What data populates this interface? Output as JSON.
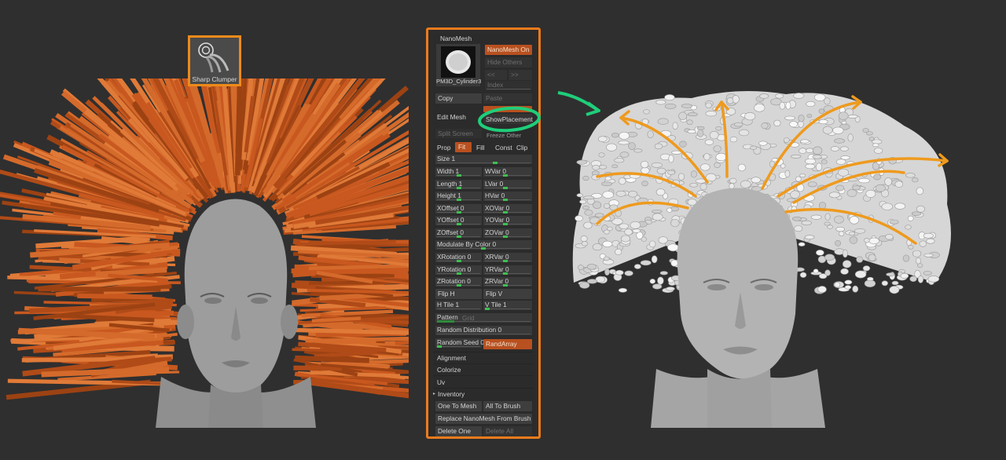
{
  "colors": {
    "accent": "#ee8a1a",
    "hair": "#c8581f",
    "highlight_circle": "#1fce7a",
    "arrow": "#ee9a1e",
    "slider": "#3fbf52"
  },
  "brush": {
    "label": "Sharp Clumper",
    "icon": "clumper-brush-icon"
  },
  "panel": {
    "title": "NanoMesh",
    "thumb_label": "PM3D_Cylinder3",
    "nanomesh_on": "NanoMesh On",
    "hide_others": "Hide Others",
    "prev": "<<",
    "next": ">>",
    "index": "Index",
    "copy": "Copy",
    "paste": "Paste",
    "edit_mesh": "Edit Mesh",
    "show_placement": "ShowPlacement",
    "split_screen": "Split Screen",
    "freeze": "Freeze Other",
    "prop": "Prop",
    "fit": "Fit",
    "fill": "Fill",
    "const": "Const",
    "clip": "Clip",
    "size": "Size 1",
    "width": "Width 1",
    "wvar": "WVar 0",
    "length": "Length 1",
    "lvar": "LVar 0",
    "height": "Height 1",
    "hvar": "HVar 0",
    "xoffset": "XOffset 0",
    "xovar": "XOVar 0",
    "yoffset": "YOffset 0",
    "yovar": "YOVar 0",
    "zoffset": "ZOffset 0",
    "zovar": "ZOVar 0",
    "modulate": "Modulate By Color 0",
    "xrot": "XRotation 0",
    "xrvar": "XRVar 0",
    "yrot": "YRotation 0",
    "yrvar": "YRVar 0",
    "zrot": "ZRotation 0",
    "zrvar": "ZRVar 0",
    "fliph": "Flip H",
    "flipv": "Flip V",
    "htile": "H Tile 1",
    "vtile": "V Tile 1",
    "pattern": "Pattern",
    "grid": "Grid",
    "random_dist": "Random Distribution 0",
    "random_seed": "Random Seed 0",
    "randarray": "RandArray",
    "alignment": "Alignment",
    "colorize": "Colorize",
    "uv": "Uv",
    "inventory": "Inventory",
    "one_to_mesh": "One To Mesh",
    "all_to_brush": "All To Brush",
    "replace": "Replace NanoMesh From Brush",
    "delete_one": "Delete One",
    "delete_all": "Delete All"
  }
}
